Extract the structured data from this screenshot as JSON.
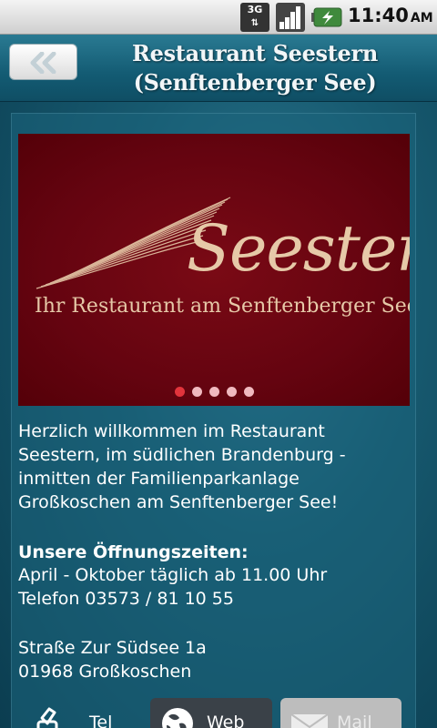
{
  "status_bar": {
    "network": "3G",
    "time": "11:40",
    "ampm": "AM"
  },
  "header": {
    "title_line1": "Restaurant Seestern",
    "title_line2": "(Senftenberger See)",
    "back_icon": "double-chevron-left-icon"
  },
  "slider": {
    "logo_name": "Seestern",
    "logo_tagline": "Ihr Restaurant am Senftenberger See",
    "slide_count": 5,
    "active_index": 0,
    "colors": {
      "background": "#650410",
      "logo": "#e6c9a8",
      "dot_active": "#e2343c",
      "dot_inactive": "#f0b9bf"
    }
  },
  "content": {
    "intro_lines": [
      "Herzlich willkommen im Restaurant",
      "Seestern, im südlichen Brandenburg -",
      "inmitten der Familienparkanlage",
      "Großkoschen am Senftenberger See!"
    ],
    "hours_title": "Unsere Öffnungszeiten:",
    "hours_line": "April - Oktober täglich ab 11.00 Uhr",
    "phone_line": "Telefon 03573 / 81 10 55",
    "address_street": "Straße Zur Südsee 1a",
    "address_city": "01968 Großkoschen"
  },
  "buttons": {
    "tel_label": "Tel",
    "web_label": "Web",
    "mail_label": "Mail"
  }
}
